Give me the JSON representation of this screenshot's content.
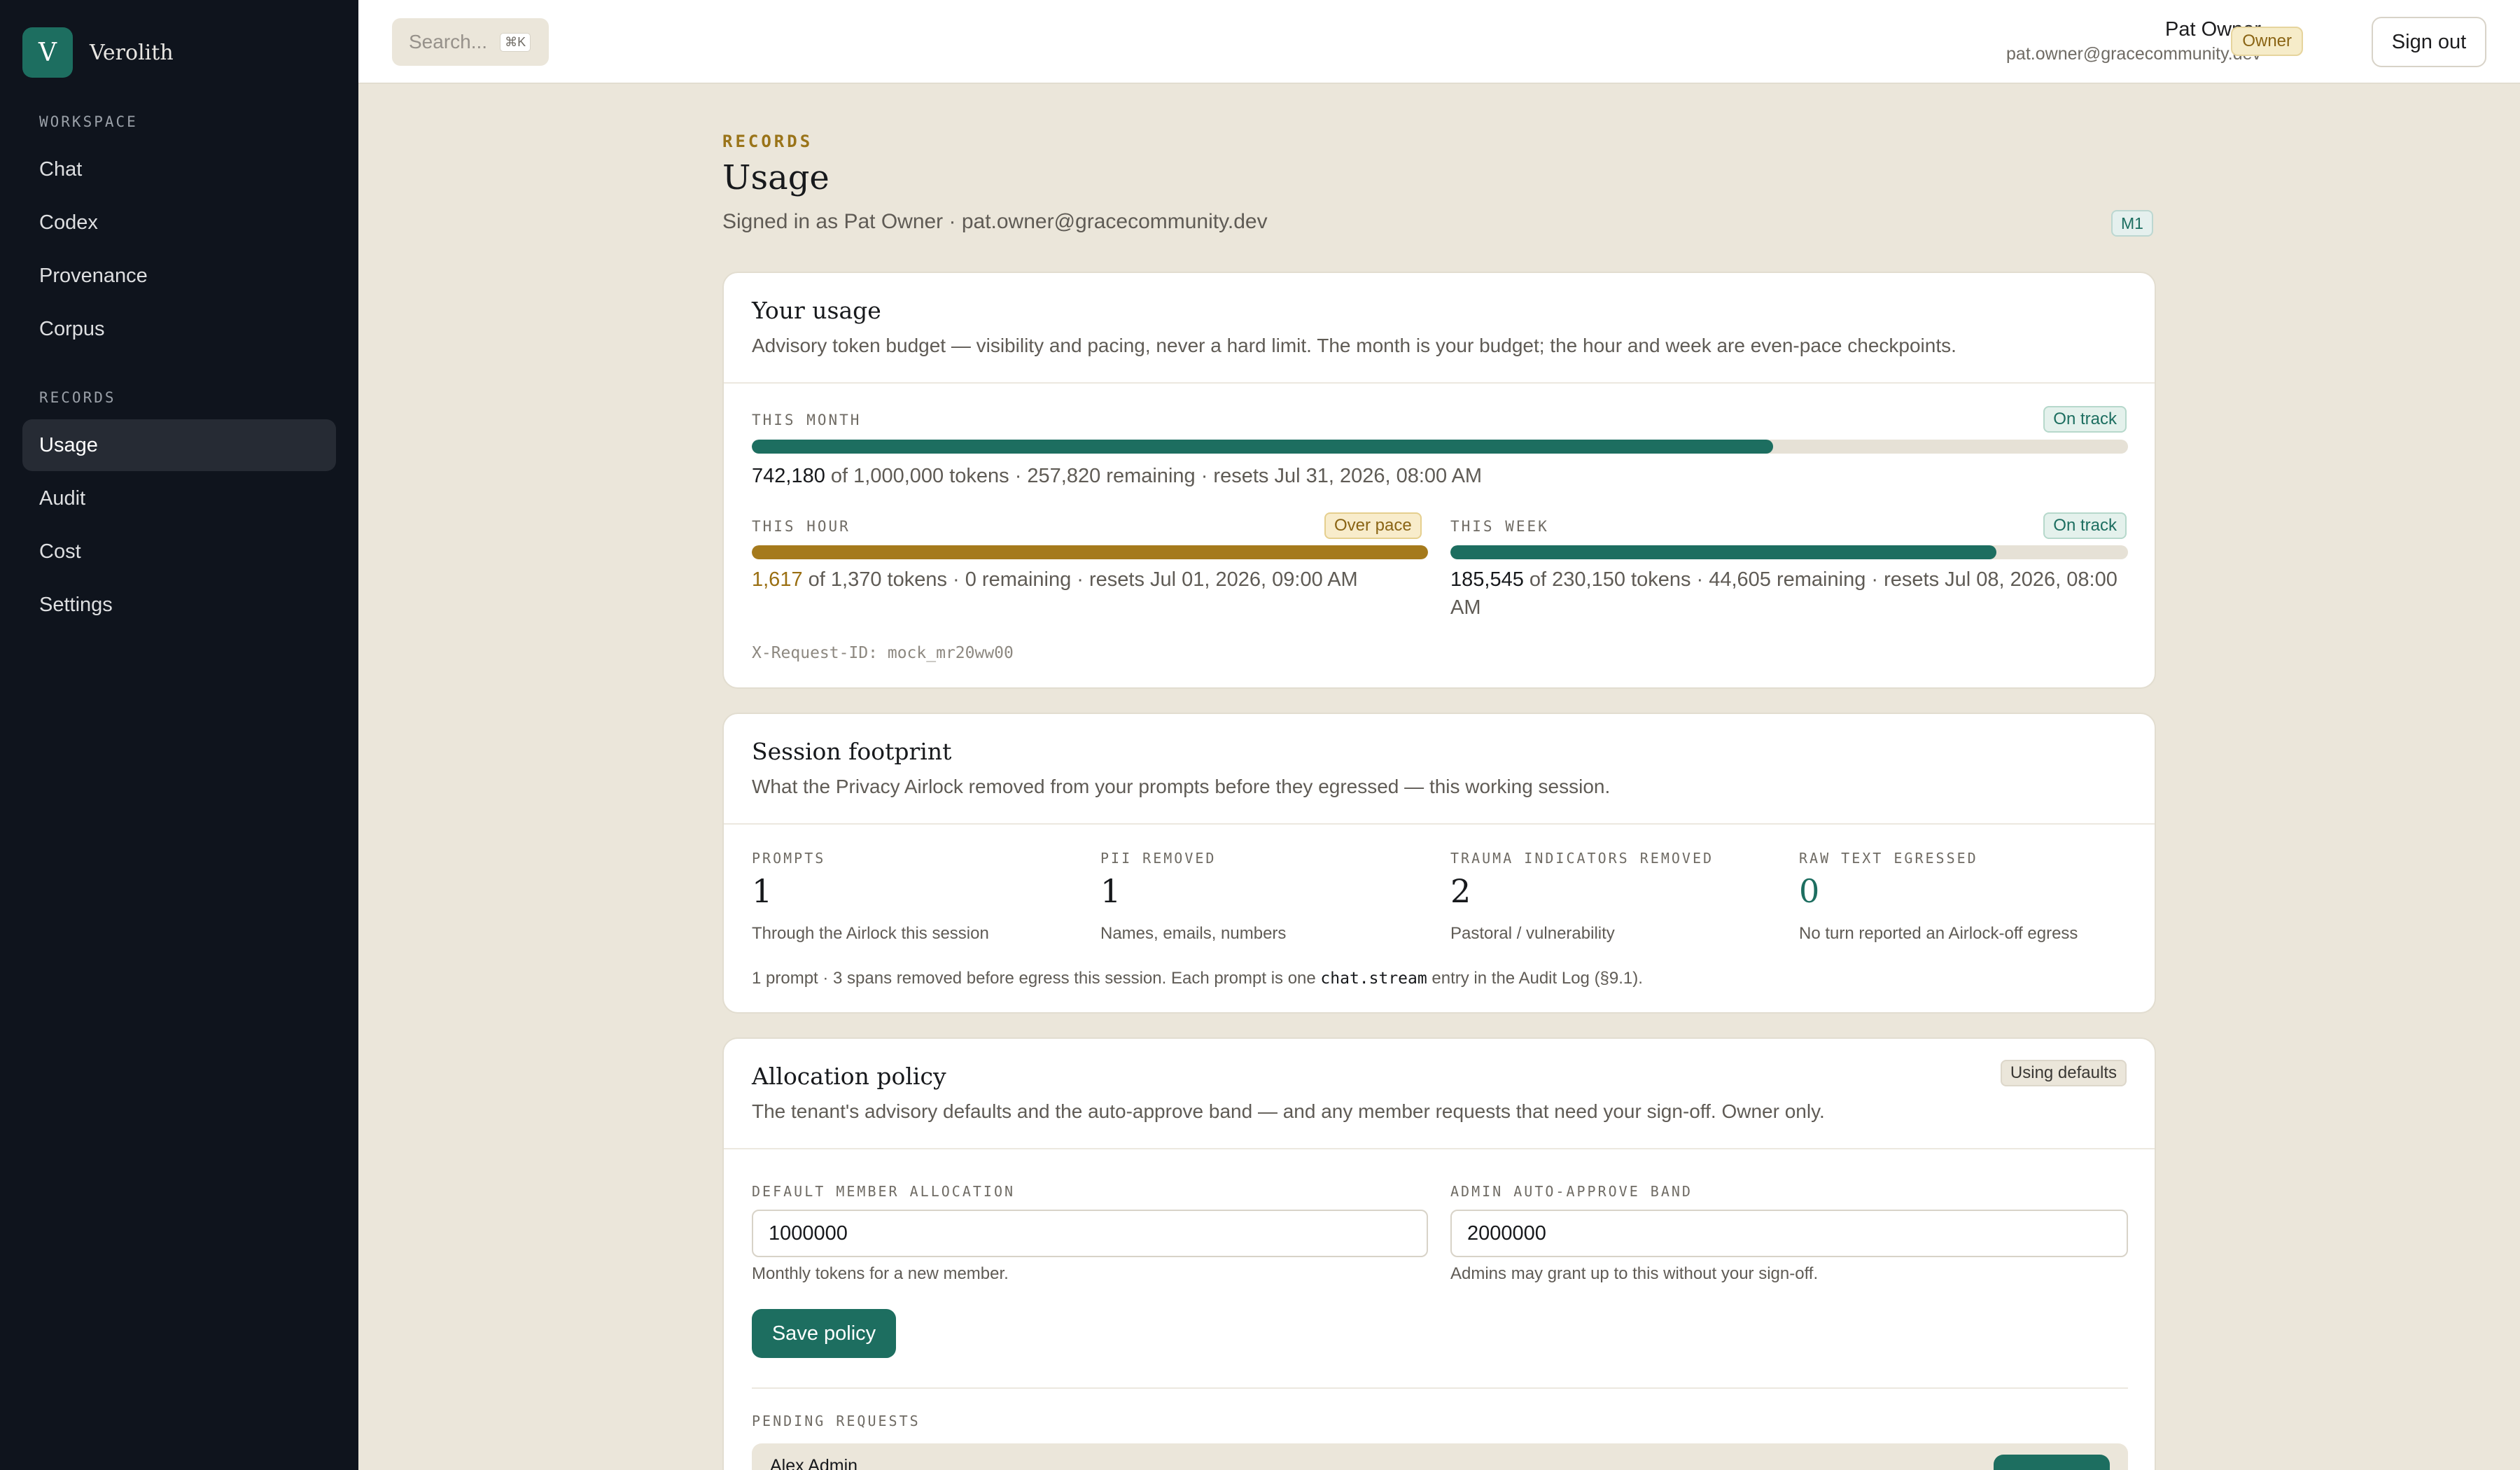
{
  "app": {
    "brand_initial": "V",
    "brand_name": "Verolith",
    "accent_color": "#1d6e60"
  },
  "sidebar": {
    "workspace_label": "WORKSPACE",
    "workspace_items": [
      {
        "label": "Chat"
      },
      {
        "label": "Codex"
      },
      {
        "label": "Provenance"
      },
      {
        "label": "Corpus"
      }
    ],
    "records_label": "RECORDS",
    "records_items": [
      {
        "label": "Usage",
        "active": true
      },
      {
        "label": "Audit"
      },
      {
        "label": "Cost"
      },
      {
        "label": "Settings"
      }
    ]
  },
  "topbar": {
    "search_placeholder": "Search...",
    "search_shortcut": "⌘K",
    "user_name": "Pat Owner",
    "user_email": "pat.owner@gracecommunity.dev",
    "role": "Owner",
    "signout_label": "Sign out"
  },
  "header": {
    "eyebrow": "RECORDS",
    "title": "Usage",
    "signed_in": "Signed in as Pat Owner · pat.owner@gracecommunity.dev",
    "milestone_badge": "M1"
  },
  "usage_card": {
    "title": "Your usage",
    "description": "Advisory token budget — visibility and pacing, never a hard limit. The month is your budget; the hour and week are even-pace checkpoints.",
    "month": {
      "label": "THIS MONTH",
      "status": "On track",
      "used": "742,180",
      "detail": " of 1,000,000 tokens · 257,820 remaining · resets Jul 31, 2026, 08:00 AM",
      "fill_fraction": 0.742
    },
    "hour": {
      "label": "THIS HOUR",
      "status": "Over pace",
      "used": "1,617",
      "detail": " of 1,370 tokens · 0 remaining · resets Jul 01, 2026, 09:00 AM",
      "fill_fraction": 1.0
    },
    "week": {
      "label": "THIS WEEK",
      "status": "On track",
      "used": "185,545",
      "detail": " of 230,150 tokens · 44,605 remaining · resets Jul 08, 2026, 08:00 AM",
      "fill_fraction": 0.806
    },
    "request_id": "X-Request-ID: mock_mr20ww00"
  },
  "session_card": {
    "title": "Session footprint",
    "description": "What the Privacy Airlock removed from your prompts before they egressed — this working session.",
    "stats": [
      {
        "label": "PROMPTS",
        "value": "1",
        "sub": "Through the Airlock this session"
      },
      {
        "label": "PII REMOVED",
        "value": "1",
        "sub": "Names, emails, numbers"
      },
      {
        "label": "TRAUMA INDICATORS REMOVED",
        "value": "2",
        "sub": "Pastoral / vulnerability"
      },
      {
        "label": "RAW TEXT EGRESSED",
        "value": "0",
        "sub": "No turn reported an Airlock-off egress"
      }
    ],
    "footnote_pre": "1 prompt · 3 spans removed before egress this session. Each prompt is one ",
    "footnote_code": "chat.stream",
    "footnote_post": " entry in the Audit Log (§9.1)."
  },
  "policy_card": {
    "title": "Allocation policy",
    "status": "Using defaults",
    "description": "The tenant's advisory defaults and the auto-approve band — and any member requests that need your sign-off. Owner only.",
    "default_allocation_label": "DEFAULT MEMBER ALLOCATION",
    "default_allocation_value": "1000000",
    "default_allocation_help": "Monthly tokens for a new member.",
    "auto_approve_label": "ADMIN AUTO-APPROVE BAND",
    "auto_approve_value": "2000000",
    "auto_approve_help": "Admins may grant up to this without your sign-off.",
    "save_label": "Save policy",
    "pending_label": "PENDING REQUESTS",
    "pending": [
      {
        "name": "Alex Admin"
      }
    ]
  }
}
